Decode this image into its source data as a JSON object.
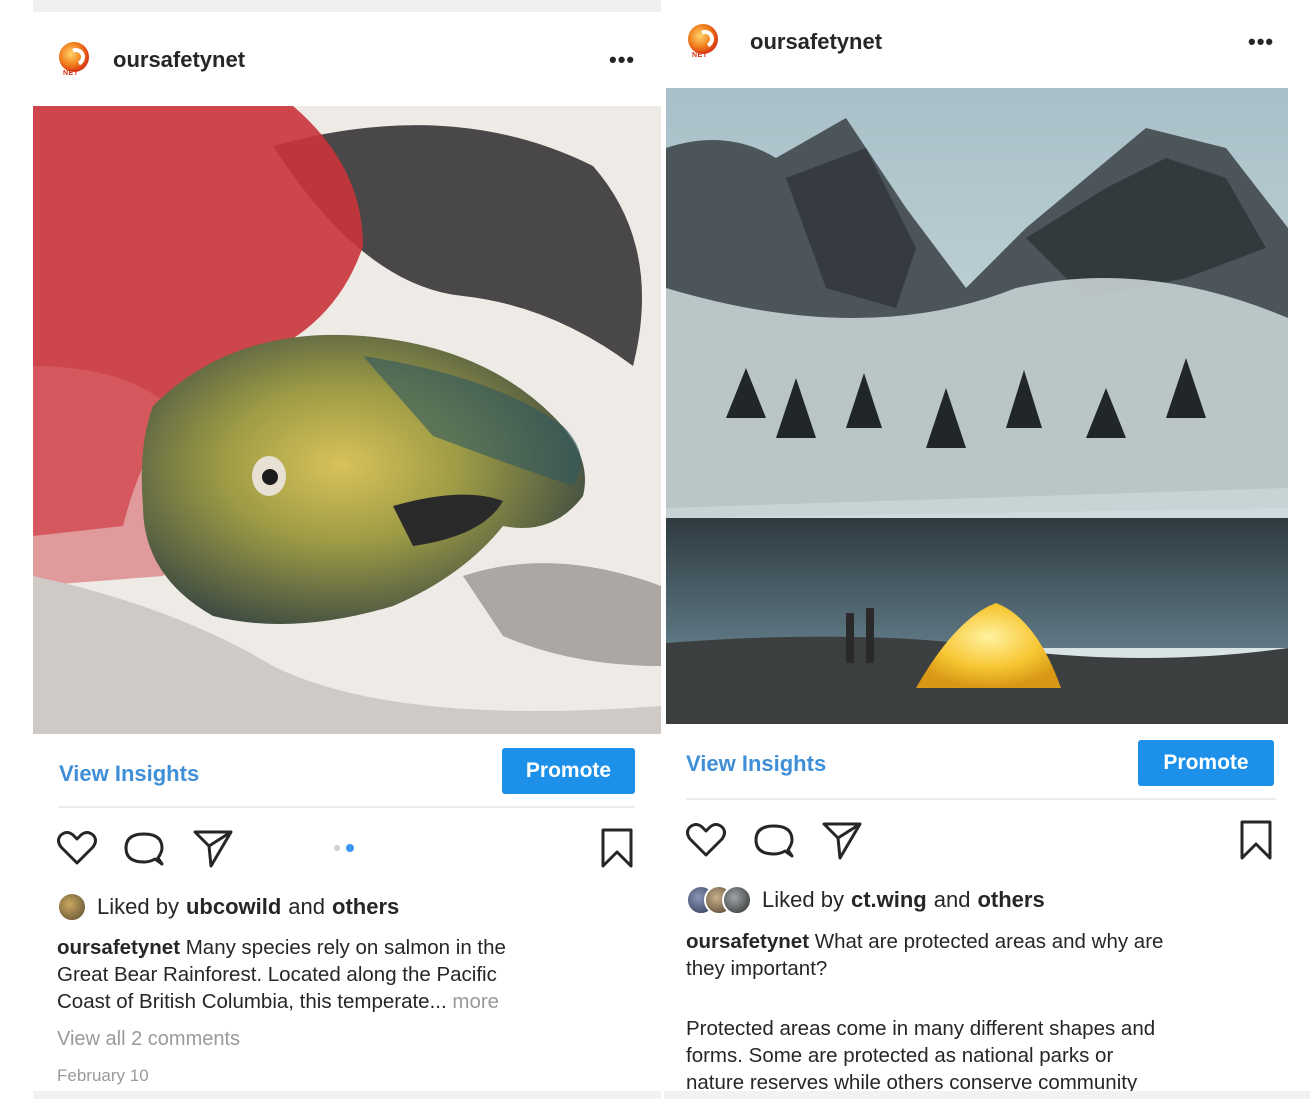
{
  "posts": [
    {
      "username": "oursafetynet",
      "avatar_text": "NET",
      "more_icon": "•••",
      "view_insights": "View Insights",
      "promote": "Promote",
      "liked_by_prefix": "Liked by",
      "liked_by_user": "ubcowild",
      "liked_by_and": "and",
      "liked_by_others": "others",
      "caption_user": "oursafetynet",
      "caption_line1": "Many species rely on salmon in the",
      "caption_line2": "Great Bear Rainforest. Located along the Pacific",
      "caption_line3": "Coast of British Columbia, this temperate...",
      "caption_more": "more",
      "comments": "View all 2 comments",
      "date": "February 10",
      "carousel_count": 2,
      "carousel_active": 2
    },
    {
      "username": "oursafetynet",
      "avatar_text": "NET",
      "more_icon": "•••",
      "view_insights": "View Insights",
      "promote": "Promote",
      "liked_by_prefix": "Liked by",
      "liked_by_user": "ct.wing",
      "liked_by_and": "and",
      "liked_by_others": "others",
      "caption_user": "oursafetynet",
      "caption_line1": "What are protected areas and why are",
      "caption_line2": "they important?",
      "caption_para2_line1": "Protected areas come in many different shapes and",
      "caption_para2_line2": "forms. Some are protected as national parks or",
      "caption_para2_line3": "nature reserves while others conserve community"
    }
  ],
  "colors": {
    "link_blue": "#3f8ed8",
    "promote_blue": "#1d91e9",
    "muted_gray": "#9a9a9a"
  }
}
